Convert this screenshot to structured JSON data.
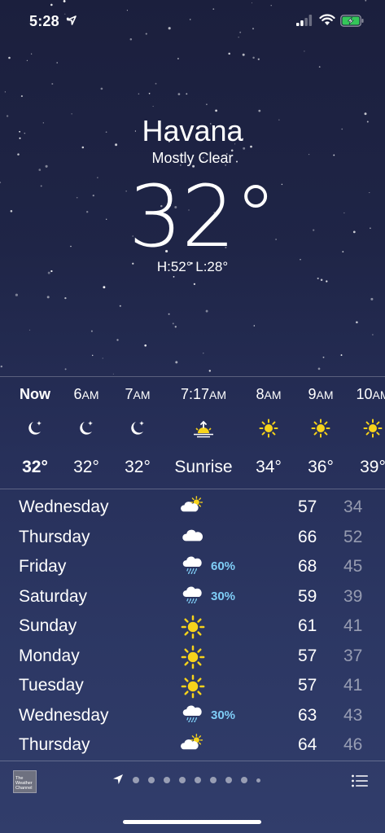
{
  "status": {
    "time": "5:28"
  },
  "header": {
    "city": "Havana",
    "condition": "Mostly Clear",
    "temperature": "32°",
    "hi_lo": "H:52°  L:28°"
  },
  "hourly": [
    {
      "time": "Now",
      "suffix": "",
      "icon": "moon-stars-icon",
      "temp": "32°",
      "bold": true
    },
    {
      "time": "6",
      "suffix": "AM",
      "icon": "moon-stars-icon",
      "temp": "32°"
    },
    {
      "time": "7",
      "suffix": "AM",
      "icon": "moon-stars-icon",
      "temp": "32°"
    },
    {
      "time": "7:17",
      "suffix": "AM",
      "icon": "sunrise-icon",
      "temp": "Sunrise"
    },
    {
      "time": "8",
      "suffix": "AM",
      "icon": "sun-icon",
      "temp": "34°"
    },
    {
      "time": "9",
      "suffix": "AM",
      "icon": "sun-icon",
      "temp": "36°"
    },
    {
      "time": "10",
      "suffix": "AM",
      "icon": "sun-icon",
      "temp": "39°"
    }
  ],
  "daily": [
    {
      "day": "Wednesday",
      "icon": "partly-cloudy-icon",
      "precip": "",
      "hi": "57",
      "lo": "34"
    },
    {
      "day": "Thursday",
      "icon": "cloud-icon",
      "precip": "",
      "hi": "66",
      "lo": "52"
    },
    {
      "day": "Friday",
      "icon": "rain-icon",
      "precip": "60%",
      "hi": "68",
      "lo": "45"
    },
    {
      "day": "Saturday",
      "icon": "rain-icon",
      "precip": "30%",
      "hi": "59",
      "lo": "39"
    },
    {
      "day": "Sunday",
      "icon": "sun-icon",
      "precip": "",
      "hi": "61",
      "lo": "41"
    },
    {
      "day": "Monday",
      "icon": "sun-icon",
      "precip": "",
      "hi": "57",
      "lo": "37"
    },
    {
      "day": "Tuesday",
      "icon": "sun-icon",
      "precip": "",
      "hi": "57",
      "lo": "41"
    },
    {
      "day": "Wednesday",
      "icon": "rain-icon",
      "precip": "30%",
      "hi": "63",
      "lo": "43"
    },
    {
      "day": "Thursday",
      "icon": "partly-cloudy-icon",
      "precip": "",
      "hi": "64",
      "lo": "46"
    }
  ],
  "footer": {
    "logo_text": "The Weather Channel",
    "page_count": 9,
    "current_page": 0
  },
  "colors": {
    "precip_text": "#7fcdf6",
    "sun_yellow": "#f7d31b",
    "sky_top": "#1b1f3d",
    "sky_bottom": "#313d6b"
  }
}
